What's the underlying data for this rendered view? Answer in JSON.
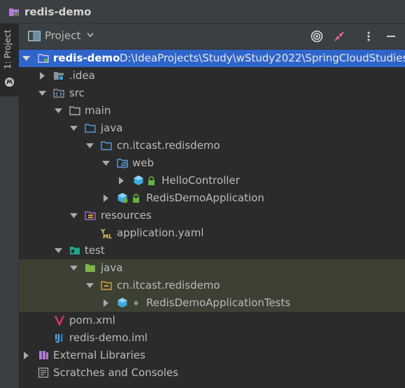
{
  "window": {
    "title": "redis-demo"
  },
  "sidebar": {
    "project_tab": "1: Project"
  },
  "tool_window": {
    "title": "Project"
  },
  "tree": {
    "root": {
      "name": "redis-demo",
      "path": "D:\\IdeaProjects\\Study\\wStudy2022\\SpringCloudStudies"
    },
    "idea": ".idea",
    "src": "src",
    "main": "main",
    "java_main": "java",
    "pkg_main": "cn.itcast.redisdemo",
    "web": "web",
    "hello_controller": "HelloController",
    "app_class": "RedisDemoApplication",
    "resources": "resources",
    "app_yaml": "application.yaml",
    "test": "test",
    "java_test": "java",
    "pkg_test": "cn.itcast.redisdemo",
    "test_class": "RedisDemoApplicationTests",
    "pom": "pom.xml",
    "iml": "redis-demo.iml",
    "ext_libs": "External Libraries",
    "scratches": "Scratches and Consoles"
  },
  "colors": {
    "selection": "#2f65ca",
    "test_highlight": "#3c4134",
    "folder": "#87939a",
    "source_folder": "#5a9bd6",
    "test_folder": "#62b543"
  }
}
